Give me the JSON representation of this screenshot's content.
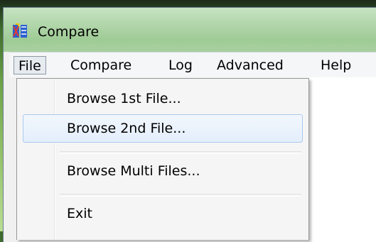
{
  "window": {
    "title": "Compare",
    "icon": "compare-app-icon"
  },
  "menubar": {
    "items": [
      {
        "label": "File",
        "active": true
      },
      {
        "label": "Compare"
      },
      {
        "label": "Log"
      },
      {
        "label": "Advanced"
      },
      {
        "label": "Help"
      }
    ]
  },
  "file_menu": {
    "items": [
      {
        "label": "Browse 1st File..."
      },
      {
        "label": "Browse 2nd File...",
        "highlighted": true
      },
      {
        "label": "Browse Multi Files..."
      },
      {
        "label": "Exit"
      }
    ]
  },
  "colors": {
    "menu_highlight_border": "#a9c9ef",
    "menu_highlight_fill": "#e3eefb",
    "titlebar": "#b5d8ae"
  }
}
